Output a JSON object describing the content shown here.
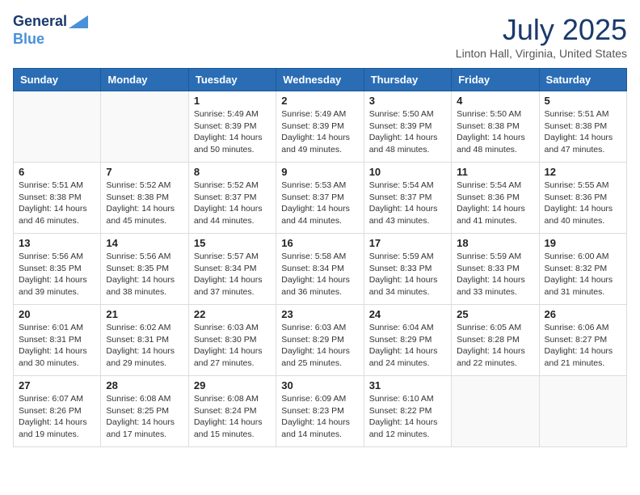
{
  "header": {
    "logo_line1": "General",
    "logo_line2": "Blue",
    "month_title": "July 2025",
    "location": "Linton Hall, Virginia, United States"
  },
  "days_of_week": [
    "Sunday",
    "Monday",
    "Tuesday",
    "Wednesday",
    "Thursday",
    "Friday",
    "Saturday"
  ],
  "weeks": [
    [
      {
        "day": "",
        "sunrise": "",
        "sunset": "",
        "daylight": ""
      },
      {
        "day": "",
        "sunrise": "",
        "sunset": "",
        "daylight": ""
      },
      {
        "day": "1",
        "sunrise": "Sunrise: 5:49 AM",
        "sunset": "Sunset: 8:39 PM",
        "daylight": "Daylight: 14 hours and 50 minutes."
      },
      {
        "day": "2",
        "sunrise": "Sunrise: 5:49 AM",
        "sunset": "Sunset: 8:39 PM",
        "daylight": "Daylight: 14 hours and 49 minutes."
      },
      {
        "day": "3",
        "sunrise": "Sunrise: 5:50 AM",
        "sunset": "Sunset: 8:39 PM",
        "daylight": "Daylight: 14 hours and 48 minutes."
      },
      {
        "day": "4",
        "sunrise": "Sunrise: 5:50 AM",
        "sunset": "Sunset: 8:38 PM",
        "daylight": "Daylight: 14 hours and 48 minutes."
      },
      {
        "day": "5",
        "sunrise": "Sunrise: 5:51 AM",
        "sunset": "Sunset: 8:38 PM",
        "daylight": "Daylight: 14 hours and 47 minutes."
      }
    ],
    [
      {
        "day": "6",
        "sunrise": "Sunrise: 5:51 AM",
        "sunset": "Sunset: 8:38 PM",
        "daylight": "Daylight: 14 hours and 46 minutes."
      },
      {
        "day": "7",
        "sunrise": "Sunrise: 5:52 AM",
        "sunset": "Sunset: 8:38 PM",
        "daylight": "Daylight: 14 hours and 45 minutes."
      },
      {
        "day": "8",
        "sunrise": "Sunrise: 5:52 AM",
        "sunset": "Sunset: 8:37 PM",
        "daylight": "Daylight: 14 hours and 44 minutes."
      },
      {
        "day": "9",
        "sunrise": "Sunrise: 5:53 AM",
        "sunset": "Sunset: 8:37 PM",
        "daylight": "Daylight: 14 hours and 44 minutes."
      },
      {
        "day": "10",
        "sunrise": "Sunrise: 5:54 AM",
        "sunset": "Sunset: 8:37 PM",
        "daylight": "Daylight: 14 hours and 43 minutes."
      },
      {
        "day": "11",
        "sunrise": "Sunrise: 5:54 AM",
        "sunset": "Sunset: 8:36 PM",
        "daylight": "Daylight: 14 hours and 41 minutes."
      },
      {
        "day": "12",
        "sunrise": "Sunrise: 5:55 AM",
        "sunset": "Sunset: 8:36 PM",
        "daylight": "Daylight: 14 hours and 40 minutes."
      }
    ],
    [
      {
        "day": "13",
        "sunrise": "Sunrise: 5:56 AM",
        "sunset": "Sunset: 8:35 PM",
        "daylight": "Daylight: 14 hours and 39 minutes."
      },
      {
        "day": "14",
        "sunrise": "Sunrise: 5:56 AM",
        "sunset": "Sunset: 8:35 PM",
        "daylight": "Daylight: 14 hours and 38 minutes."
      },
      {
        "day": "15",
        "sunrise": "Sunrise: 5:57 AM",
        "sunset": "Sunset: 8:34 PM",
        "daylight": "Daylight: 14 hours and 37 minutes."
      },
      {
        "day": "16",
        "sunrise": "Sunrise: 5:58 AM",
        "sunset": "Sunset: 8:34 PM",
        "daylight": "Daylight: 14 hours and 36 minutes."
      },
      {
        "day": "17",
        "sunrise": "Sunrise: 5:59 AM",
        "sunset": "Sunset: 8:33 PM",
        "daylight": "Daylight: 14 hours and 34 minutes."
      },
      {
        "day": "18",
        "sunrise": "Sunrise: 5:59 AM",
        "sunset": "Sunset: 8:33 PM",
        "daylight": "Daylight: 14 hours and 33 minutes."
      },
      {
        "day": "19",
        "sunrise": "Sunrise: 6:00 AM",
        "sunset": "Sunset: 8:32 PM",
        "daylight": "Daylight: 14 hours and 31 minutes."
      }
    ],
    [
      {
        "day": "20",
        "sunrise": "Sunrise: 6:01 AM",
        "sunset": "Sunset: 8:31 PM",
        "daylight": "Daylight: 14 hours and 30 minutes."
      },
      {
        "day": "21",
        "sunrise": "Sunrise: 6:02 AM",
        "sunset": "Sunset: 8:31 PM",
        "daylight": "Daylight: 14 hours and 29 minutes."
      },
      {
        "day": "22",
        "sunrise": "Sunrise: 6:03 AM",
        "sunset": "Sunset: 8:30 PM",
        "daylight": "Daylight: 14 hours and 27 minutes."
      },
      {
        "day": "23",
        "sunrise": "Sunrise: 6:03 AM",
        "sunset": "Sunset: 8:29 PM",
        "daylight": "Daylight: 14 hours and 25 minutes."
      },
      {
        "day": "24",
        "sunrise": "Sunrise: 6:04 AM",
        "sunset": "Sunset: 8:29 PM",
        "daylight": "Daylight: 14 hours and 24 minutes."
      },
      {
        "day": "25",
        "sunrise": "Sunrise: 6:05 AM",
        "sunset": "Sunset: 8:28 PM",
        "daylight": "Daylight: 14 hours and 22 minutes."
      },
      {
        "day": "26",
        "sunrise": "Sunrise: 6:06 AM",
        "sunset": "Sunset: 8:27 PM",
        "daylight": "Daylight: 14 hours and 21 minutes."
      }
    ],
    [
      {
        "day": "27",
        "sunrise": "Sunrise: 6:07 AM",
        "sunset": "Sunset: 8:26 PM",
        "daylight": "Daylight: 14 hours and 19 minutes."
      },
      {
        "day": "28",
        "sunrise": "Sunrise: 6:08 AM",
        "sunset": "Sunset: 8:25 PM",
        "daylight": "Daylight: 14 hours and 17 minutes."
      },
      {
        "day": "29",
        "sunrise": "Sunrise: 6:08 AM",
        "sunset": "Sunset: 8:24 PM",
        "daylight": "Daylight: 14 hours and 15 minutes."
      },
      {
        "day": "30",
        "sunrise": "Sunrise: 6:09 AM",
        "sunset": "Sunset: 8:23 PM",
        "daylight": "Daylight: 14 hours and 14 minutes."
      },
      {
        "day": "31",
        "sunrise": "Sunrise: 6:10 AM",
        "sunset": "Sunset: 8:22 PM",
        "daylight": "Daylight: 14 hours and 12 minutes."
      },
      {
        "day": "",
        "sunrise": "",
        "sunset": "",
        "daylight": ""
      },
      {
        "day": "",
        "sunrise": "",
        "sunset": "",
        "daylight": ""
      }
    ]
  ]
}
